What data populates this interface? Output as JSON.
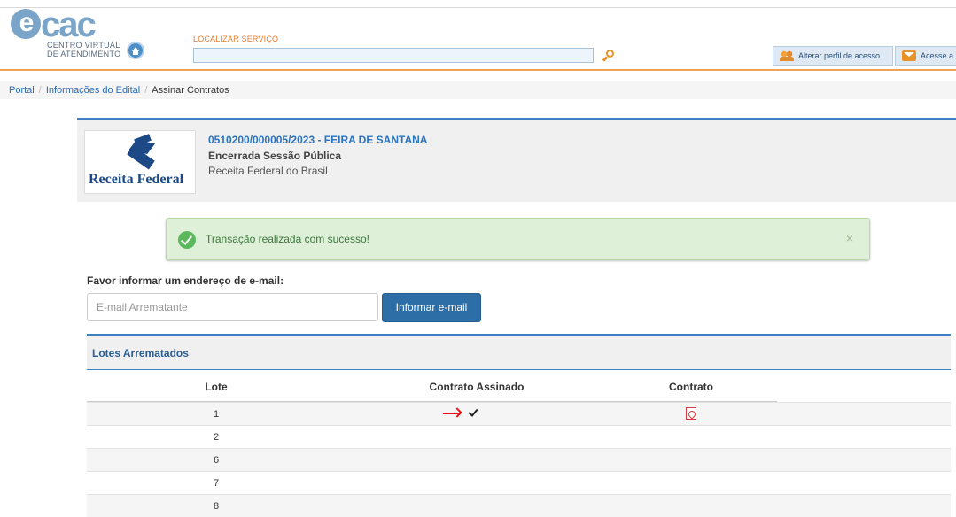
{
  "header": {
    "logo_text": "cac",
    "logo_sub1": "CENTRO VIRTUAL",
    "logo_sub2": "DE ATENDIMENTO",
    "search_label": "LOCALIZAR SERVIÇO",
    "search_value": "",
    "btn_perfil": "Alterar perfil de acesso",
    "btn_acesse": "Acesse a"
  },
  "breadcrumb": {
    "items": [
      "Portal",
      "Informações do Edital",
      "Assinar Contratos"
    ]
  },
  "edital": {
    "logo_text": "Receita Federal",
    "title": "0510200/000005/2023 - FEIRA DE SANTANA",
    "status": "Encerrada Sessão Pública",
    "org": "Receita Federal do Brasil"
  },
  "alert": {
    "message": "Transação realizada com sucesso!",
    "close": "×"
  },
  "email": {
    "label": "Favor informar um endereço de e-mail:",
    "placeholder": "E-mail Arrematante",
    "button": "Informar e-mail"
  },
  "lotes": {
    "title": "Lotes Arrematados",
    "columns": [
      "Lote",
      "Contrato Assinado",
      "Contrato"
    ],
    "rows": [
      {
        "lote": "1",
        "assinado": true,
        "contrato": true
      },
      {
        "lote": "2",
        "assinado": false,
        "contrato": false
      },
      {
        "lote": "6",
        "assinado": false,
        "contrato": false
      },
      {
        "lote": "7",
        "assinado": false,
        "contrato": false
      },
      {
        "lote": "8",
        "assinado": false,
        "contrato": false
      }
    ]
  },
  "colors": {
    "accent": "#3b82c4",
    "header_orange": "#f0a257",
    "success_bg": "#dff0d8",
    "button_blue": "#2e6ea7"
  }
}
